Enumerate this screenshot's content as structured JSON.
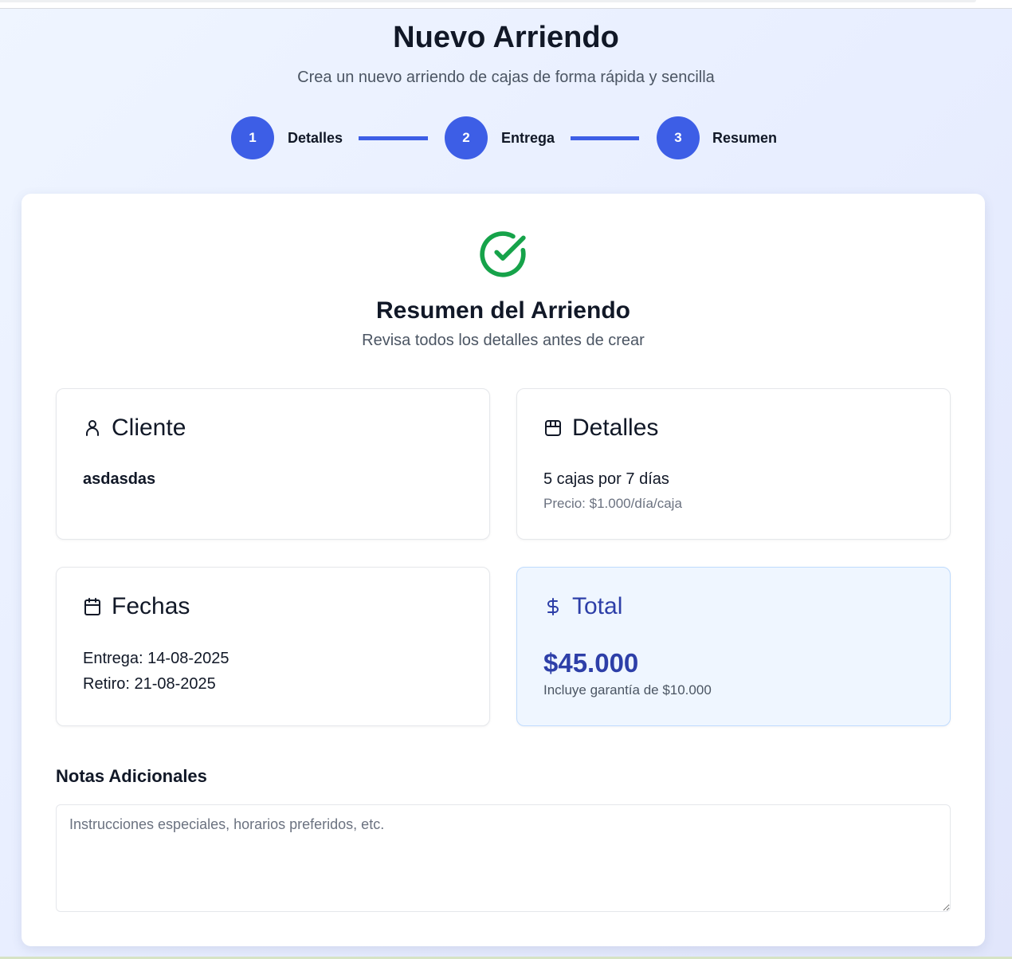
{
  "header": {
    "title": "Nuevo Arriendo",
    "subtitle": "Crea un nuevo arriendo de cajas de forma rápida y sencilla"
  },
  "steps": [
    {
      "number": "1",
      "label": "Detalles"
    },
    {
      "number": "2",
      "label": "Entrega"
    },
    {
      "number": "3",
      "label": "Resumen"
    }
  ],
  "colors": {
    "accent": "#3d5ee6",
    "success": "#16a34a",
    "total_text": "#2d3fa8",
    "total_bg": "#eff6ff"
  },
  "summary": {
    "icon": "check-circle-icon",
    "title": "Resumen del Arriendo",
    "subtitle": "Revisa todos los detalles antes de crear",
    "client": {
      "icon": "user-icon",
      "title": "Cliente",
      "name": "asdasdas"
    },
    "details": {
      "icon": "package-icon",
      "title": "Detalles",
      "quantity": "5 cajas por 7 días",
      "price": "Precio: $1.000/día/caja"
    },
    "dates": {
      "icon": "calendar-icon",
      "title": "Fechas",
      "delivery": "Entrega: 14-08-2025",
      "pickup": "Retiro: 21-08-2025"
    },
    "total": {
      "icon": "dollar-icon",
      "title": "Total",
      "amount": "$45.000",
      "note": "Incluye garantía de $10.000"
    }
  },
  "notes": {
    "label": "Notas Adicionales",
    "value": "",
    "placeholder": "Instrucciones especiales, horarios preferidos, etc."
  }
}
